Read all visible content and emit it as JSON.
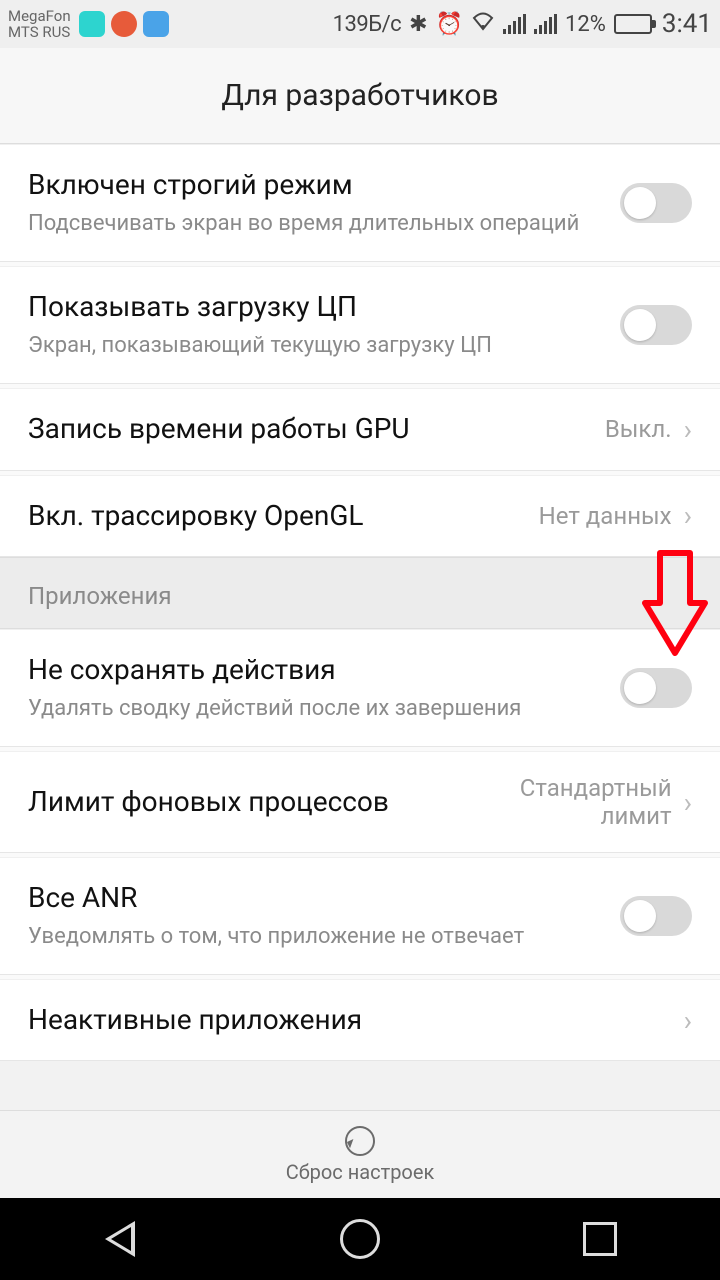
{
  "status": {
    "carrier_line1": "MegaFon",
    "carrier_line2": "MTS RUS",
    "speed": "139Б/с",
    "battery_pct": "12%",
    "time": "3:41"
  },
  "header": {
    "title": "Для разработчиков"
  },
  "rows": {
    "strict": {
      "title": "Включен строгий режим",
      "sub": "Подсвечивать экран во время длительных операций"
    },
    "cpu": {
      "title": "Показывать загрузку ЦП",
      "sub": "Экран, показывающий текущую загрузку ЦП"
    },
    "gpu": {
      "title": "Запись времени работы GPU",
      "value": "Выкл."
    },
    "opengl": {
      "title": "Вкл. трассировку OpenGL",
      "value": "Нет данных"
    },
    "section_apps": "Приложения",
    "no_keep": {
      "title": "Не сохранять действия",
      "sub": "Удалять сводку действий после их завершения"
    },
    "bg_limit": {
      "title": "Лимит фоновых процессов",
      "value": "Стандартный лимит"
    },
    "anr": {
      "title": "Все ANR",
      "sub": "Уведомлять о том, что приложение не отвечает"
    },
    "inactive": {
      "title": "Неактивные приложения"
    }
  },
  "reset": {
    "label": "Сброс настроек"
  }
}
